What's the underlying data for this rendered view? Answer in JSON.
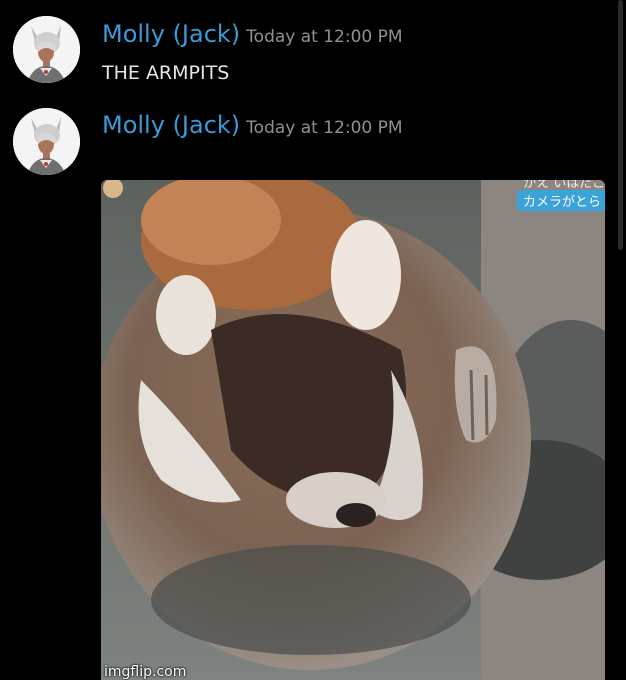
{
  "messages": [
    {
      "author": "Molly (Jack)",
      "timestamp": "Today at 12:00 PM",
      "text": "THE ARMPITS"
    },
    {
      "author": "Molly (Jack)",
      "timestamp": "Today at 12:00 PM",
      "attachment": {
        "watermark": "imgflip.com",
        "caption_tag": "カメラがとら",
        "caption_top": "かえ いはたこ"
      }
    }
  ],
  "colors": {
    "background": "#000000",
    "username": "#3a9ad9",
    "timestamp": "#8e9297",
    "text": "#e6e6e6"
  }
}
